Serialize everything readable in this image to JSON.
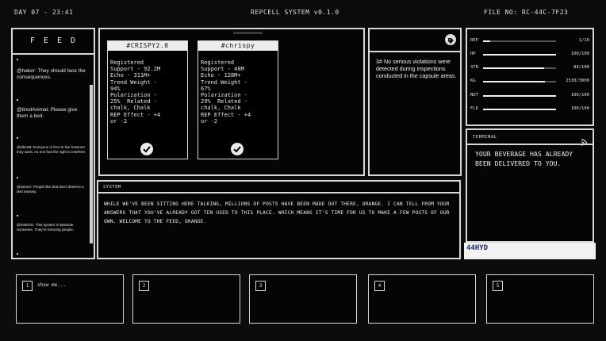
{
  "topbar": {
    "day": "DAY 07 - 23:41",
    "system": "REPCELL SYSTEM v0.1.0",
    "file": "FILE NO: RC-44C-7F23"
  },
  "feed": {
    "title": "FEED",
    "messages": [
      "@haker: They should face the consequences.",
      "@tiredAnimal: Please give them a bed.",
      "@silentB: Everyone is free to live however they want, no one has the right to interfere.",
      "@winner: People like that don't deserve a bed anyway.",
      "@halDOG: This system is absolute nonsense. They're torturing people."
    ]
  },
  "posts": [
    {
      "title": "#CRISPY2.0",
      "body": "Registered\nSupport - 92.2M\nEcho - 311M+\nTrend Weight -\n94%\nPolarization -\n25%  Related -\nchalk, Chalk\nREP Effect - +4\nor -2"
    },
    {
      "title": "#chrispy",
      "body": "Registered\nSupport - 40M\nEcho - 128M+\nTrend Weight -\n67%\nPolarization -\n29%  Related -\nchalk, Chalk\nREP Effect - +4\nor -2"
    }
  ],
  "inspection": {
    "text": "3# No serious violations were detected during inspections conducted in the capsule areas."
  },
  "stats": [
    {
      "label": "REP",
      "value": "1/10",
      "fraction": 0.1
    },
    {
      "label": "HP",
      "value": "100/100",
      "fraction": 1.0
    },
    {
      "label": "STR",
      "value": "84/100",
      "fraction": 0.84
    },
    {
      "label": "KG",
      "value": "2530/3000",
      "fraction": 0.843
    },
    {
      "label": "NUT",
      "value": "100/100",
      "fraction": 1.0
    },
    {
      "label": "FLD",
      "value": "100/100",
      "fraction": 1.0
    }
  ],
  "terminal": {
    "title": "TERMINAL",
    "message": "YOUR BEVERAGE HAS ALREADY BEEN DELIVERED TO YOU.",
    "code": "44HYD"
  },
  "system": {
    "title": "SYSTEM",
    "message": "WHILE WE'VE BEEN SITTING HERE TALKING, MILLIONS OF POSTS HAVE BEEN MADE OUT THERE, ORANGE. I CAN TELL FROM YOUR ANSWERS THAT YOU'VE ALREADY GOT TEN USED TO THIS PLACE. WHICH MEANS IT'S TIME FOR US TO MAKE A FEW POSTS OF OUR OWN. WELCOME TO THE FEED, ORANGE."
  },
  "slots": [
    {
      "num": "1",
      "label": "show me..."
    },
    {
      "num": "2",
      "label": ""
    },
    {
      "num": "3",
      "label": ""
    },
    {
      "num": "4",
      "label": ""
    },
    {
      "num": "5",
      "label": ""
    }
  ],
  "colors": {
    "background": "#0c0c0c",
    "frame": "#d8d8d8",
    "text": "#e8e8e8",
    "code": "#1e2a6e"
  }
}
